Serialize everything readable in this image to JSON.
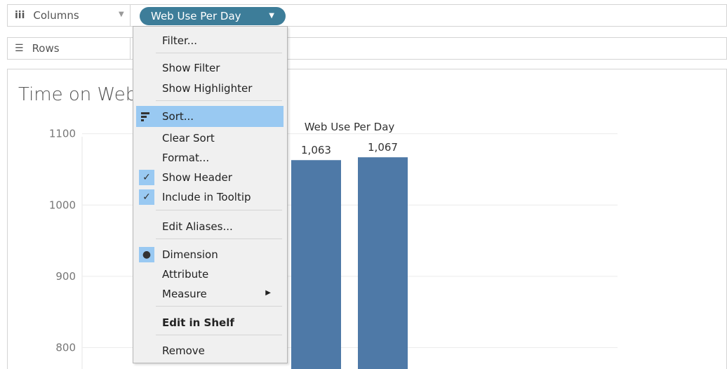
{
  "shelves": {
    "columns_label": "Columns",
    "rows_label": "Rows",
    "columns_pill": "Web Use Per Day"
  },
  "view": {
    "title": "Time on Web"
  },
  "menu": {
    "filter": "Filter...",
    "show_filter": "Show Filter",
    "show_highlighter": "Show Highlighter",
    "sort": "Sort...",
    "clear_sort": "Clear Sort",
    "format": "Format...",
    "show_header": "Show Header",
    "include_tooltip": "Include in Tooltip",
    "edit_aliases": "Edit Aliases...",
    "dimension": "Dimension",
    "attribute": "Attribute",
    "measure": "Measure",
    "edit_in_shelf": "Edit in Shelf",
    "remove": "Remove"
  },
  "chart_data": {
    "type": "bar",
    "header": "Web Use Per Day",
    "yticks": [
      800,
      900,
      1000,
      1100
    ],
    "ylim": [
      770,
      1140
    ],
    "values": [
      1063,
      1067
    ],
    "value_labels": [
      "1,063",
      "1,067"
    ],
    "bar_color": "#4e79a7",
    "grid": true
  },
  "colors": {
    "pill": "#3d7d99",
    "menu_highlight": "#99c9f2"
  }
}
